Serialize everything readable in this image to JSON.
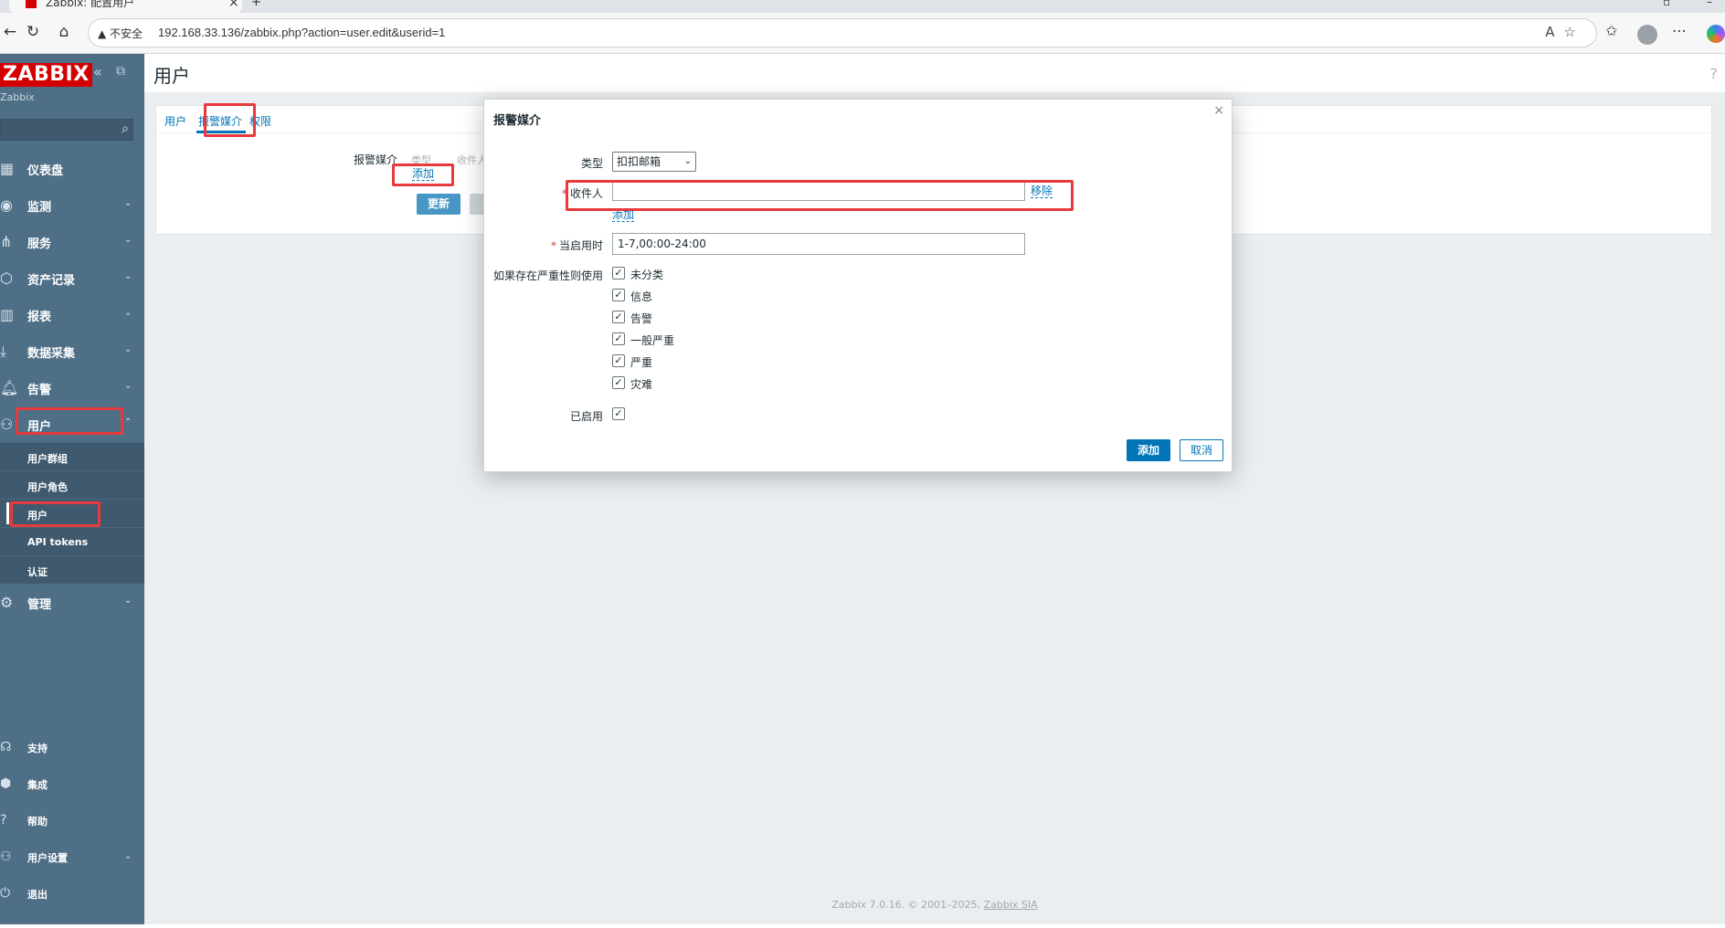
{
  "browser": {
    "tab_title": "Zabbix: 配置用户",
    "tab_close": "×",
    "new_tab": "+",
    "security_label": "▲ 不安全",
    "url": "192.168.33.136/zabbix.php?action=user.edit&userid=1"
  },
  "sidebar": {
    "logo": "ZABBIX",
    "server_name": "Zabbix",
    "menu": [
      {
        "label": "仪表盘",
        "icon": "dashboard-icon",
        "has_children": false
      },
      {
        "label": "监测",
        "icon": "monitoring-icon",
        "has_children": true
      },
      {
        "label": "服务",
        "icon": "services-icon",
        "has_children": true
      },
      {
        "label": "资产记录",
        "icon": "inventory-icon",
        "has_children": true
      },
      {
        "label": "报表",
        "icon": "reports-icon",
        "has_children": true
      },
      {
        "label": "数据采集",
        "icon": "data-collection-icon",
        "has_children": true
      },
      {
        "label": "告警",
        "icon": "alerts-icon",
        "has_children": true
      },
      {
        "label": "用户",
        "icon": "users-icon",
        "has_children": true,
        "expanded": true
      }
    ],
    "users_submenu": [
      "用户群组",
      "用户角色",
      "用户",
      "API tokens",
      "认证"
    ],
    "admin_label": "管理",
    "bottom": [
      {
        "label": "支持",
        "icon": "support-icon"
      },
      {
        "label": "集成",
        "icon": "integrations-icon"
      },
      {
        "label": "帮助",
        "icon": "help-icon"
      },
      {
        "label": "用户设置",
        "icon": "user-settings-icon"
      },
      {
        "label": "退出",
        "icon": "signout-icon"
      }
    ]
  },
  "page": {
    "title": "用户",
    "help": "?",
    "tabs": [
      "用户",
      "报警媒介",
      "权限"
    ],
    "media_label": "报警媒介",
    "media_col_type": "类型",
    "media_col_recipient": "收件人",
    "media_add": "添加",
    "update_button": "更新",
    "footer_prefix": "Zabbix 7.0.16. © 2001–2025, ",
    "footer_link": "Zabbix SIA"
  },
  "modal": {
    "title": "报警媒介",
    "close": "×",
    "type_label": "类型",
    "type_value": "扣扣邮箱",
    "recipient_label": "收件人",
    "recipient_value": "",
    "remove_link": "移除",
    "add_link": "添加",
    "when_active_label": "当启用时",
    "when_active_value": "1-7,00:00-24:00",
    "severity_label": "如果存在严重性则使用",
    "severities": [
      {
        "label": "未分类",
        "checked": true
      },
      {
        "label": "信息",
        "checked": true
      },
      {
        "label": "告警",
        "checked": true
      },
      {
        "label": "一般严重",
        "checked": true
      },
      {
        "label": "严重",
        "checked": true
      },
      {
        "label": "灾难",
        "checked": true
      }
    ],
    "enabled_label": "已启用",
    "enabled": true,
    "add_button": "添加",
    "cancel_button": "取消"
  },
  "colors": {
    "sidebar_bg": "#4f6f87",
    "logo_bg": "#d40000",
    "accent": "#0275b8",
    "highlight": "#e8393c"
  }
}
